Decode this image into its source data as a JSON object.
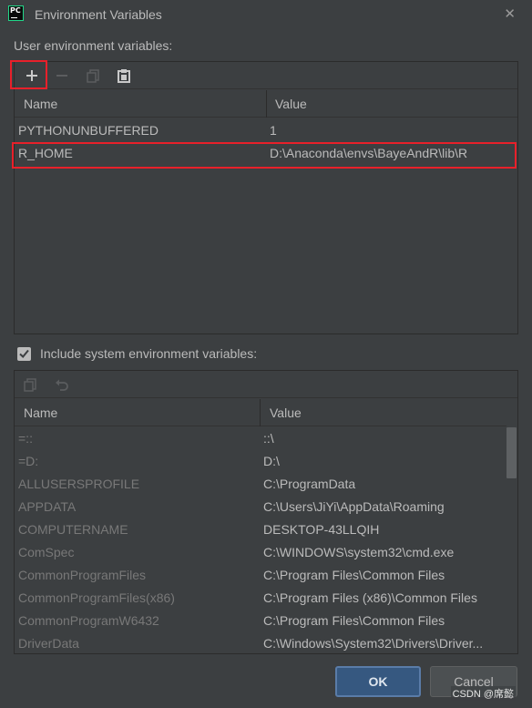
{
  "window": {
    "title": "Environment Variables",
    "app_icon_text": "PC",
    "close_glyph": "✕"
  },
  "user_section": {
    "label": "User environment variables:",
    "toolbar": {
      "add_glyph": "+",
      "remove_glyph": "−"
    },
    "columns": [
      "Name",
      "Value"
    ],
    "rows": [
      {
        "name": "PYTHONUNBUFFERED",
        "value": "1"
      },
      {
        "name": "R_HOME",
        "value": "D:\\Anaconda\\envs\\BayeAndR\\lib\\R"
      }
    ]
  },
  "system_section": {
    "checkbox_label": "Include system environment variables:",
    "checked": true,
    "columns": [
      "Name",
      "Value"
    ],
    "rows": [
      {
        "name": "=::",
        "value": "::\\"
      },
      {
        "name": "=D:",
        "value": "D:\\"
      },
      {
        "name": "ALLUSERSPROFILE",
        "value": "C:\\ProgramData"
      },
      {
        "name": "APPDATA",
        "value": "C:\\Users\\JiYi\\AppData\\Roaming"
      },
      {
        "name": "COMPUTERNAME",
        "value": "DESKTOP-43LLQIH"
      },
      {
        "name": "ComSpec",
        "value": "C:\\WINDOWS\\system32\\cmd.exe"
      },
      {
        "name": "CommonProgramFiles",
        "value": "C:\\Program Files\\Common Files"
      },
      {
        "name": "CommonProgramFiles(x86)",
        "value": "C:\\Program Files (x86)\\Common Files"
      },
      {
        "name": "CommonProgramW6432",
        "value": "C:\\Program Files\\Common Files"
      },
      {
        "name": "DriverData",
        "value": "C:\\Windows\\System32\\Drivers\\Driver..."
      }
    ]
  },
  "buttons": {
    "ok": "OK",
    "cancel": "Cancel"
  },
  "watermark": "CSDN @席懿",
  "colors": {
    "background": "#3c3f41",
    "highlight": "#e8202a",
    "ok_button": "#365880"
  }
}
